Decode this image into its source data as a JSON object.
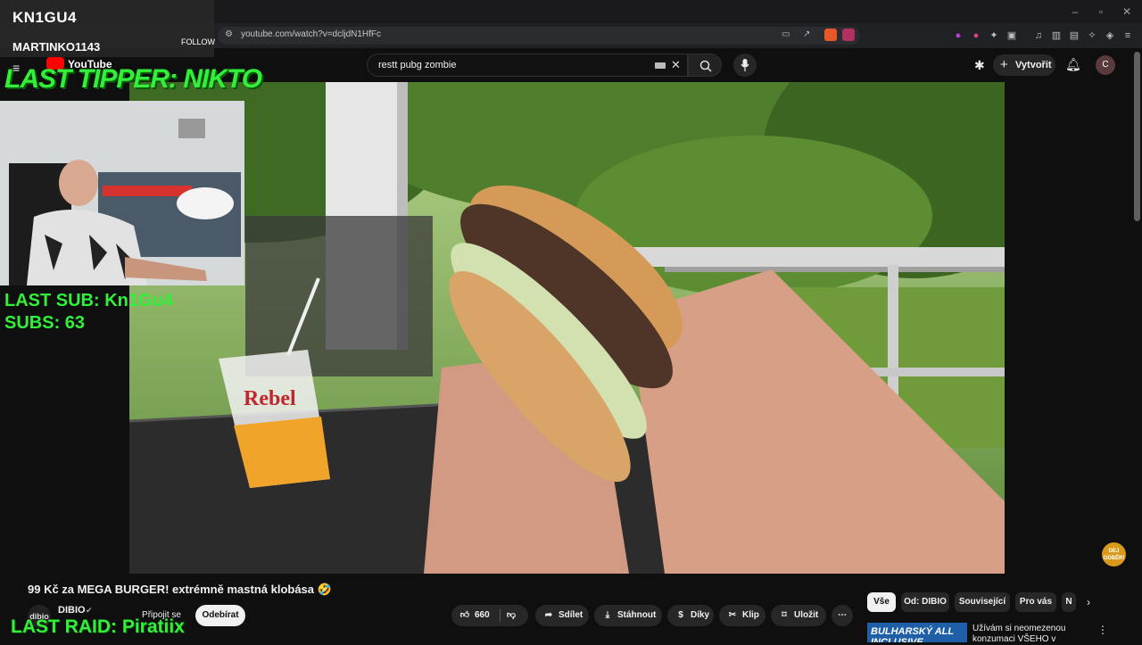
{
  "browser": {
    "url": "youtube.com/watch?v=dcljdN1HfFc"
  },
  "youtube": {
    "logo_text": "YouTube",
    "search_value": "restt pubg zombie",
    "create_label": "Vytvořit",
    "avatar_letter": "C"
  },
  "overlay": {
    "streamer_name": "KN1GU4",
    "latest_follower": "MARTINKO1143",
    "follow_label": "FOLLOW",
    "last_tipper": "LAST TIPPER: NIKTO",
    "last_sub": "LAST SUB: Kn1Gu4",
    "subs": "SUBS: 63",
    "last_raid": "LAST RAID: Piratiix",
    "cup_text": "Rebel"
  },
  "video": {
    "title": "99 Kč za MEGA BURGER! extrémně mastná klobása 🤣",
    "channel_avatar": "dibio",
    "channel_name": "DIBIO",
    "join_label": "Připojit se",
    "subscribe_label": "Odebírat",
    "likes": "660",
    "share_label": "Sdílet",
    "download_label": "Stáhnout",
    "thanks_label": "Díky",
    "clip_label": "Klip",
    "save_label": "Uložit",
    "subscribe_badge": "DEJ ODBĚR!"
  },
  "chips": [
    "Vše",
    "Od: DIBIO",
    "Související",
    "Pro vás",
    "N"
  ],
  "recommendation": {
    "thumb_text": "BULHARSKÝ ALL INCLUSIVE",
    "title": "Užívám si neomezenou konzumaci VŠEHO v"
  }
}
